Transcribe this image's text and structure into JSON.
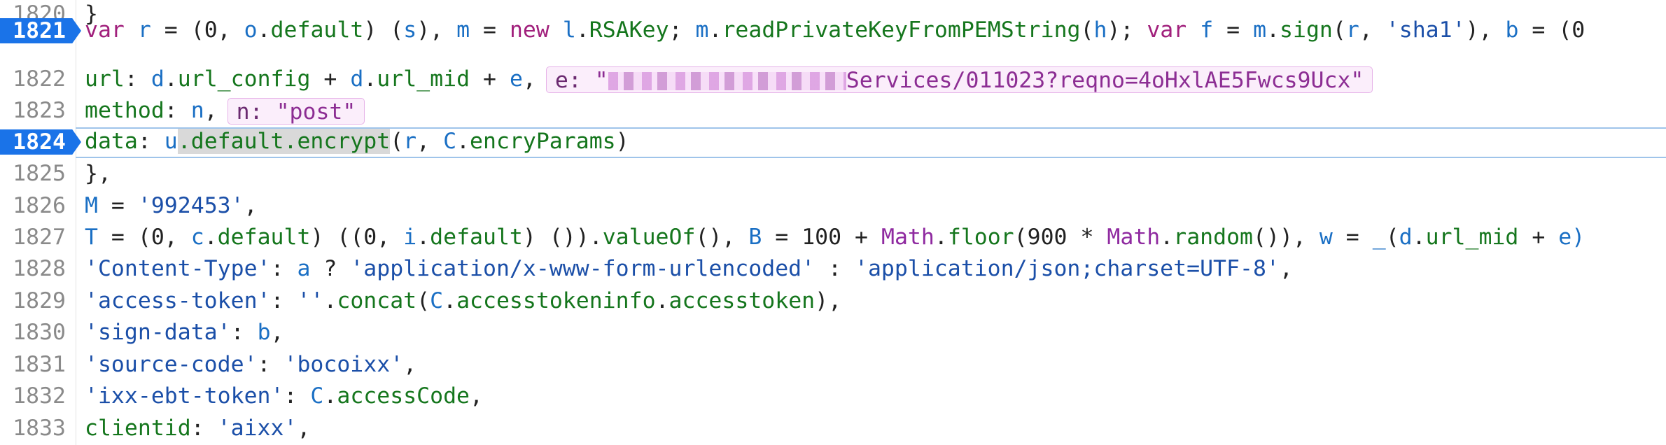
{
  "colors": {
    "breakpoint": "#1a73e8",
    "keyword": "#a1207c",
    "identifier": "#1a6fc4",
    "property": "#15761d",
    "string": "#1b4fa8",
    "tooltip_bg": "#fbeefb"
  },
  "lines": {
    "l1820": {
      "num": "1820",
      "t1": "}"
    },
    "l1821": {
      "num": "1821",
      "t1": "var",
      "t2": " ",
      "t3": "r",
      "t4": " = (0, ",
      "t5": "o",
      "t6": ".",
      "t7": "default",
      "t8": ") (",
      "t9": "s",
      "t10": "), ",
      "t11": "m",
      "t12": " = ",
      "t13": "new",
      "t14": " ",
      "t15": "l",
      "t16": ".",
      "t17": "RSAKey",
      "t18": "; ",
      "t19": "m",
      "t20": ".",
      "t21": "readPrivateKeyFromPEMString",
      "t22": "(",
      "t23": "h",
      "t24": "); ",
      "t25": "var",
      "t26": " ",
      "t27": "f",
      "t28": " = ",
      "t29": "m",
      "t30": ".",
      "t31": "sign",
      "t32": "(",
      "t33": "r",
      "t34": ", ",
      "t35": "'sha1'",
      "t36": "), ",
      "t37": "b",
      "t38": " = (0"
    },
    "l1822": {
      "num": "1822",
      "t1": "url",
      "t2": ": ",
      "t3": "d",
      "t4": ".",
      "t5": "url_config",
      "t6": " + ",
      "t7": "d",
      "t8": ".",
      "t9": "url_mid",
      "t10": " + ",
      "t11": "e",
      "t12": ",",
      "tip_key": "e:",
      "tip_open": "\"",
      "tip_rest": "Services/011023?reqno=4oHxlAE5Fwcs9Ucx\""
    },
    "l1823": {
      "num": "1823",
      "t1": "method",
      "t2": ": ",
      "t3": "n",
      "t4": ",",
      "tip_key": "n:",
      "tip_val": "\"post\""
    },
    "l1824": {
      "num": "1824",
      "t1": "data",
      "t2": ": ",
      "t3": "u",
      "t4": ".default.encrypt",
      "t5": "(",
      "t6": "r",
      "t7": ", ",
      "t8": "C",
      "t9": ".",
      "t10": "encryParams",
      "t11": ")"
    },
    "l1825": {
      "num": "1825",
      "t1": "},"
    },
    "l1826": {
      "num": "1826",
      "t1": "M",
      "t2": " = ",
      "t3": "'992453'",
      "t4": ","
    },
    "l1827": {
      "num": "1827",
      "t1": "T",
      "t2": " = (0, ",
      "t3": "c",
      "t4": ".",
      "t5": "default",
      "t6": ") ((0, ",
      "t7": "i",
      "t8": ".",
      "t9": "default",
      "t10": ") ()).",
      "t11": "valueOf",
      "t12": "(), ",
      "t13": "B",
      "t14": " = 100 + ",
      "t15": "Math",
      "t16": ".",
      "t17": "floor",
      "t18": "(900 * ",
      "t19": "Math",
      "t20": ".",
      "t21": "random",
      "t22": "()), ",
      "t23": "w",
      "t24": " = ",
      "t25": "_",
      "t26": "(",
      "t27": "d",
      "t28": ".",
      "t29": "url_mid",
      "t30": " + ",
      "t31": "e)"
    },
    "l1828": {
      "num": "1828",
      "t1": "'Content-Type'",
      "t2": ": ",
      "t3": "a",
      "t4": " ? ",
      "t5": "'application/x-www-form-urlencoded'",
      "t6": " : ",
      "t7": "'application/json;charset=UTF-8'",
      "t8": ","
    },
    "l1829": {
      "num": "1829",
      "t1": "'access-token'",
      "t2": ": ",
      "t3": "''",
      "t4": ".",
      "t5": "concat",
      "t6": "(",
      "t7": "C",
      "t8": ".",
      "t9": "accesstokeninfo",
      "t10": ".",
      "t11": "accesstoken",
      "t12": "),"
    },
    "l1830": {
      "num": "1830",
      "t1": "'sign-data'",
      "t2": ": ",
      "t3": "b",
      "t4": ","
    },
    "l1831": {
      "num": "1831",
      "t1": "'source-code'",
      "t2": ": ",
      "t3": "'bocoixx'",
      "t4": ","
    },
    "l1832": {
      "num": "1832",
      "t1": "'ixx-ebt-token'",
      "t2": ": ",
      "t3": "C",
      "t4": ".",
      "t5": "accessCode",
      "t6": ","
    },
    "l1833": {
      "num": "1833",
      "t1": "clientid",
      "t2": ": ",
      "t3": "'aixx'",
      "t4": ","
    }
  }
}
